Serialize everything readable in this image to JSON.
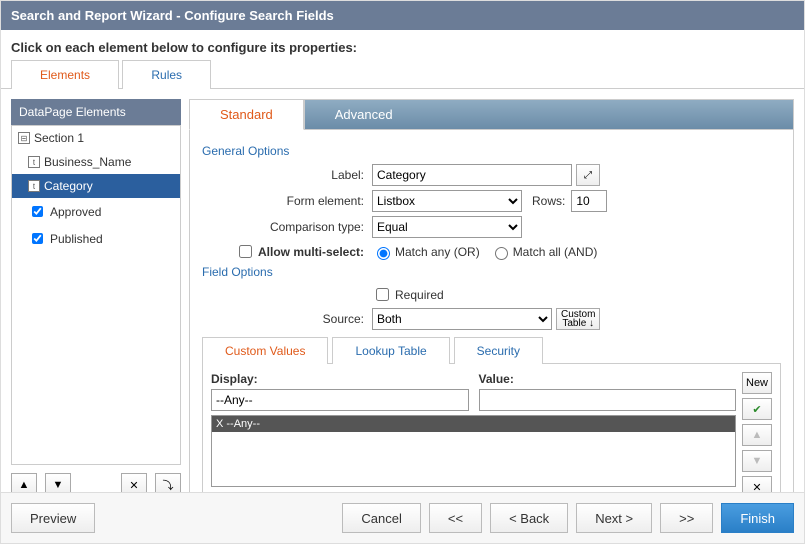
{
  "title": "Search and Report Wizard - Configure Search Fields",
  "instruction": "Click on each element below to configure its properties:",
  "mainTabs": {
    "elements": "Elements",
    "rules": "Rules"
  },
  "leftPanel": {
    "header": "DataPage Elements",
    "items": [
      {
        "label": "Section 1",
        "type": "section"
      },
      {
        "label": "Business_Name",
        "type": "text"
      },
      {
        "label": "Category",
        "type": "text",
        "selected": true
      },
      {
        "label": "Approved",
        "type": "check"
      },
      {
        "label": "Published",
        "type": "check"
      }
    ]
  },
  "configTabs": {
    "standard": "Standard",
    "advanced": "Advanced"
  },
  "sections": {
    "general": "General Options",
    "field": "Field Options"
  },
  "form": {
    "labelLbl": "Label:",
    "labelVal": "Category",
    "formElLbl": "Form element:",
    "formElVal": "Listbox",
    "rowsLbl": "Rows:",
    "rowsVal": "10",
    "compLbl": "Comparison type:",
    "compVal": "Equal",
    "multiLbl": "Allow multi-select:",
    "matchAny": "Match any (OR)",
    "matchAll": "Match all (AND)",
    "requiredLbl": "Required",
    "sourceLbl": "Source:",
    "sourceVal": "Both",
    "customTableBtn": "Custom Table ↓"
  },
  "subTabs": {
    "custom": "Custom Values",
    "lookup": "Lookup Table",
    "security": "Security"
  },
  "values": {
    "displayHdr": "Display:",
    "valueHdr": "Value:",
    "displayVal": "--Any--",
    "valueVal": "",
    "listRow": "X --Any--",
    "newBtn": "New"
  },
  "footer": {
    "preview": "Preview",
    "cancel": "Cancel",
    "first": "<<",
    "back": "< Back",
    "next": "Next >",
    "last": ">>",
    "finish": "Finish"
  }
}
